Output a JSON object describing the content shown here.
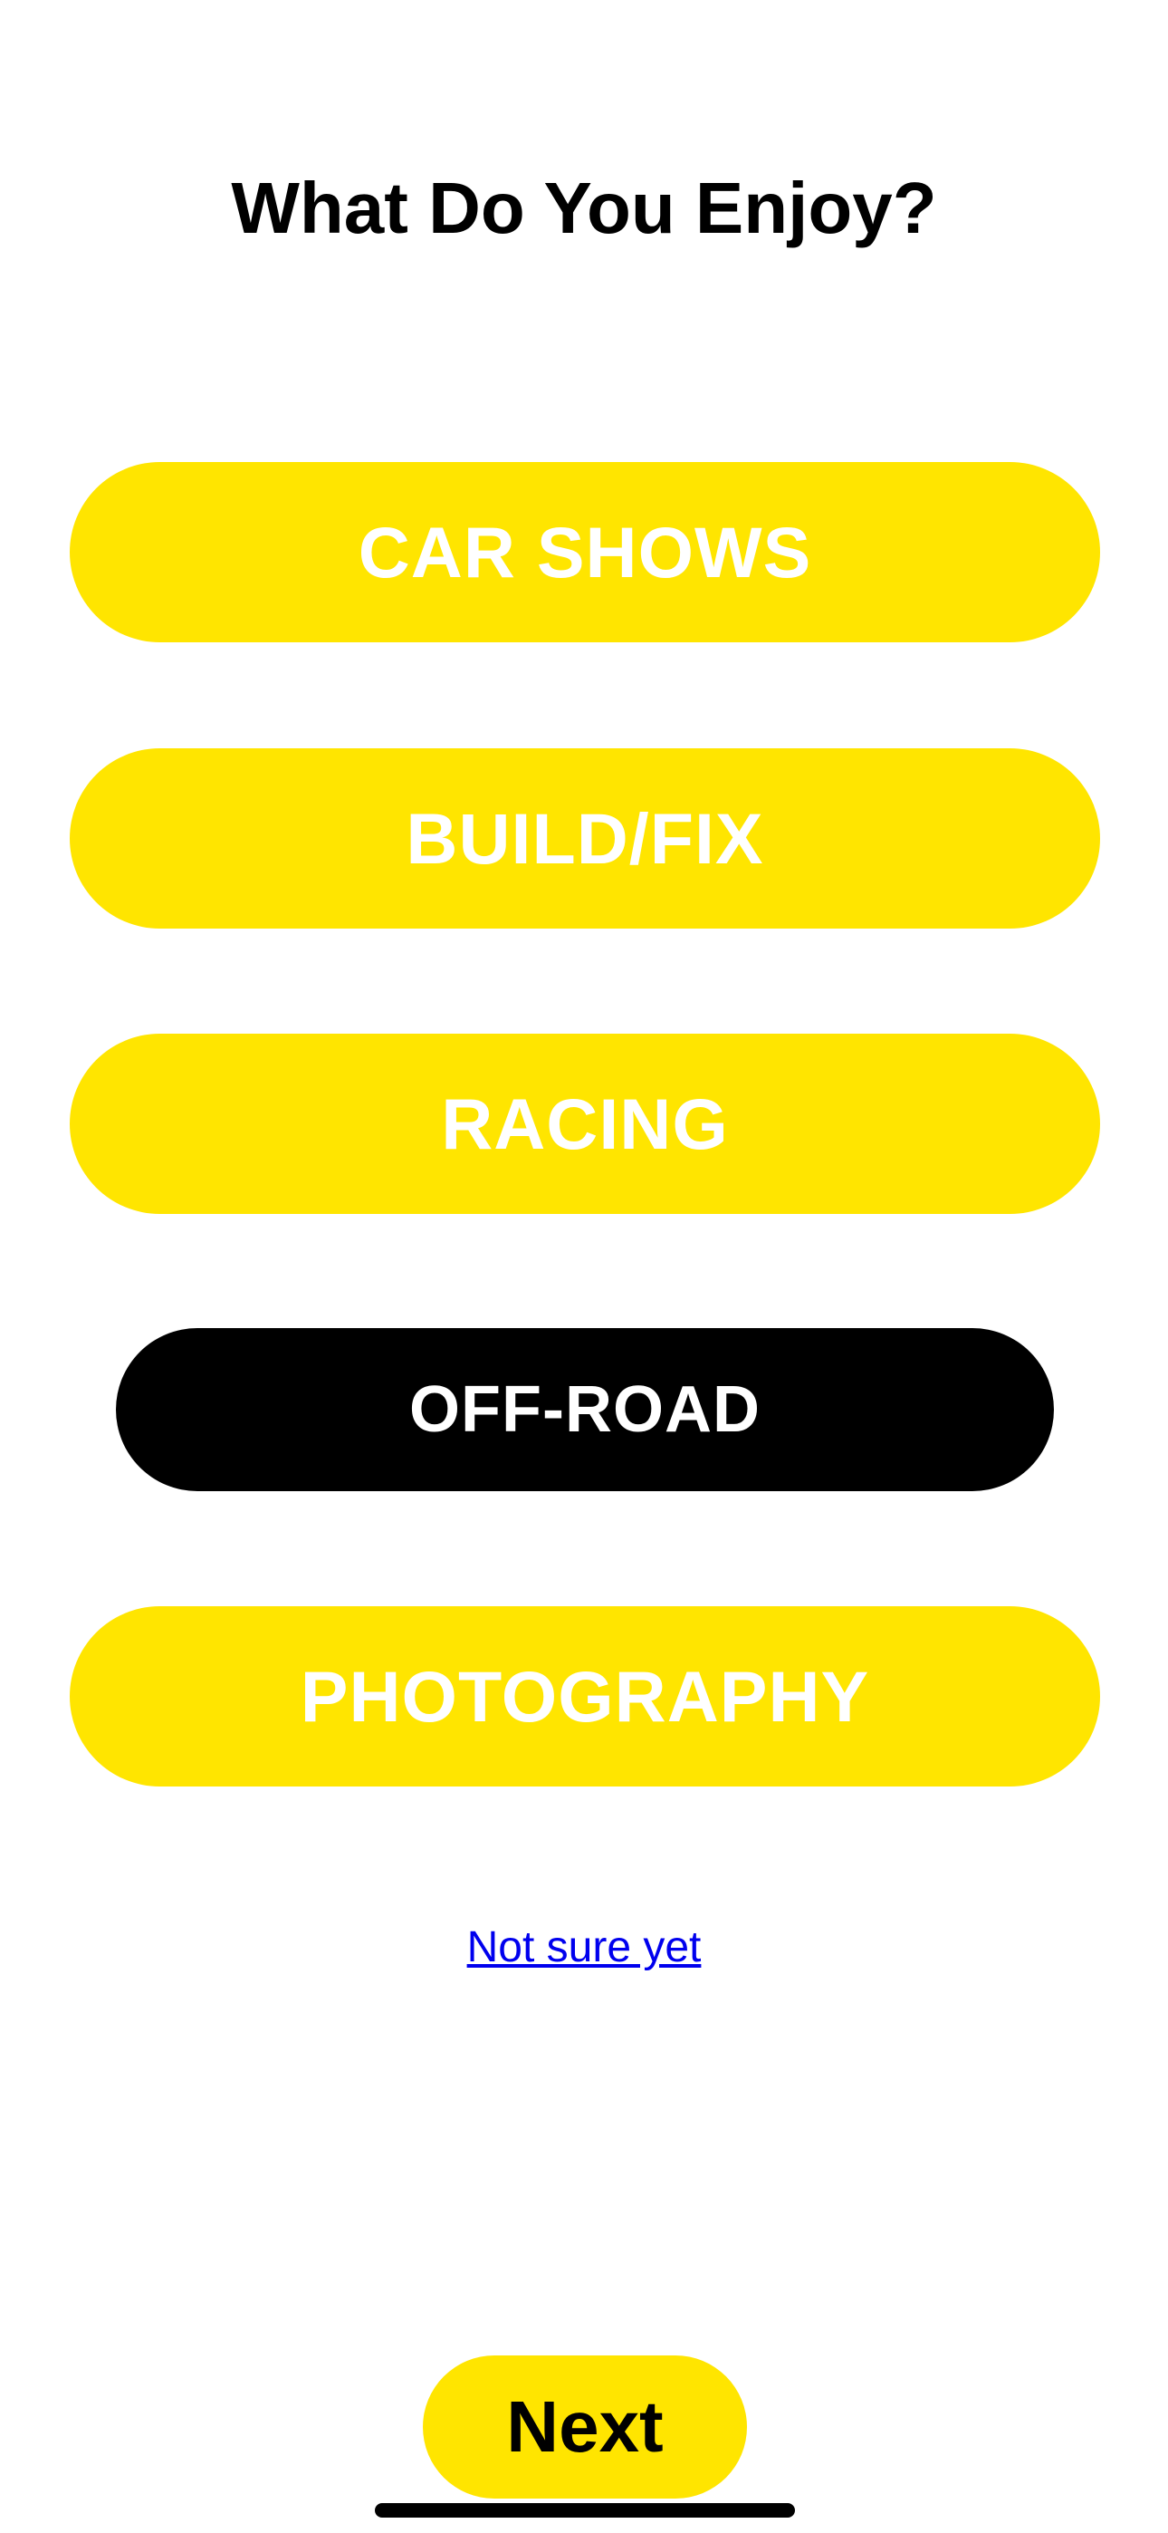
{
  "header": {
    "title": "What Do You Enjoy?"
  },
  "options": [
    {
      "label": "CAR SHOWS",
      "selected": false
    },
    {
      "label": "BUILD/FIX",
      "selected": false
    },
    {
      "label": "RACING",
      "selected": false
    },
    {
      "label": "OFF-ROAD",
      "selected": true
    },
    {
      "label": "PHOTOGRAPHY",
      "selected": false
    }
  ],
  "skip": {
    "label": "Not sure yet"
  },
  "footer": {
    "next_label": "Next"
  },
  "colors": {
    "accent": "#FFE500",
    "selected_bg": "#000000",
    "option_text": "#FFFFFF",
    "link": "#0000EE"
  }
}
